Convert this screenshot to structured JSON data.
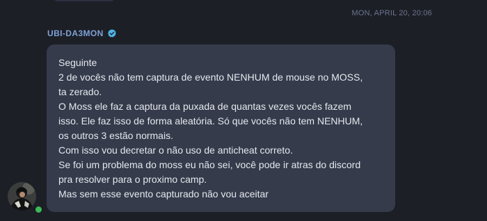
{
  "message": {
    "timestamp": "MON, APRIL 20, 20:06",
    "author": {
      "name": "UBI-DA3MON",
      "verified": true,
      "status": "online",
      "status_color": "#3dba58",
      "name_color": "#7ea2d6"
    },
    "lines": [
      "Seguinte",
      "2 de vocês não tem captura de evento NENHUM de mouse no MOSS,",
      "ta zerado.",
      "O Moss ele faz a captura da puxada de quantas vezes vocês fazem",
      "isso. Ele faz isso de forma aleatória. Só que vocês não tem NENHUM,",
      "os outros 3 estão normais.",
      "Com isso vou decretar o não uso de anticheat correto.",
      "Se foi um problema do moss eu não sei, você pode ir atras do discord",
      "pra resolver para o proximo camp.",
      "Mas sem esse evento capturado não vou aceitar"
    ]
  },
  "theme": {
    "background": "#1c1f26",
    "bubble": "#353b4b",
    "text": "#e6e8ee",
    "timestamp": "#6d7590"
  }
}
